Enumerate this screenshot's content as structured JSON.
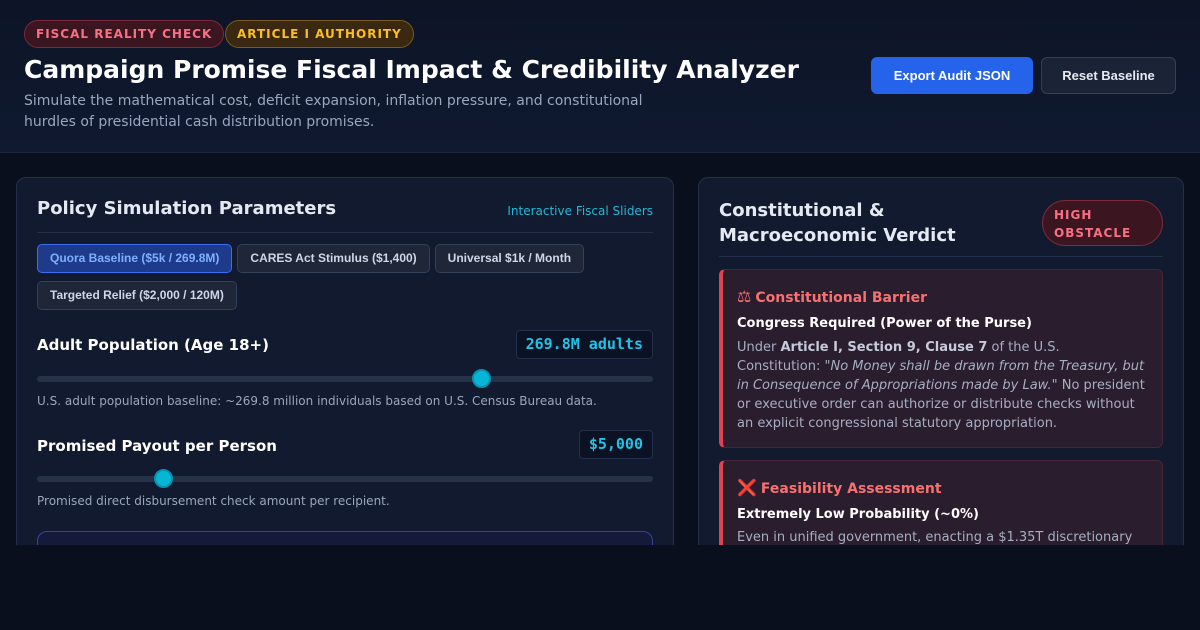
{
  "header": {
    "badges": [
      "FISCAL REALITY CHECK",
      "ARTICLE I AUTHORITY"
    ],
    "title": "Campaign Promise Fiscal Impact & Credibility Analyzer",
    "subtitle": "Simulate the mathematical cost, deficit expansion, inflation pressure, and constitutional hurdles of presidential cash distribution promises.",
    "export_label": "Export Audit JSON",
    "reset_label": "Reset Baseline"
  },
  "parameters": {
    "title": "Policy Simulation Parameters",
    "link": "Interactive Fiscal Sliders",
    "presets": [
      {
        "label": "Quora Baseline ($5k / 269.8M)",
        "active": true
      },
      {
        "label": "CARES Act Stimulus ($1,400)",
        "active": false
      },
      {
        "label": "Universal $1k / Month",
        "active": false
      },
      {
        "label": "Targeted Relief ($2,000 / 120M)",
        "active": false
      }
    ],
    "population": {
      "label": "Adult Population (Age 18+)",
      "value": "269.8M adults",
      "slider_fraction": 0.72,
      "help": "U.S. adult population baseline: ~269.8 million individuals based on U.S. Census Bureau data."
    },
    "payout": {
      "label": "Promised Payout per Person",
      "value": "$5,000",
      "slider_fraction": 0.205,
      "help": "Promised direct disbursement check amount per recipient."
    }
  },
  "verdict": {
    "title": "Constitutional & Macroeconomic Verdict",
    "risk_level": "HIGH OBSTACLE",
    "cards": [
      {
        "icon": "⚖",
        "heading": "Constitutional Barrier",
        "subheading": "Congress Required (Power of the Purse)",
        "body_prefix": "Under ",
        "body_bold": "Article I, Section 9, Clause 7",
        "body_mid": " of the U.S. Constitution: \"",
        "body_italic": "No Money shall be drawn from the Treasury, but in Consequence of Appropriations made by Law.",
        "body_suffix": "\" No president or executive order can authorize or distribute checks without an explicit congressional statutory appropriation."
      },
      {
        "icon": "❌",
        "heading": "Feasibility Assessment",
        "subheading": "Extremely Low Probability (~0%)",
        "body": "Even in unified government, enacting a $1.35T discretionary"
      }
    ]
  },
  "colors": {
    "accent": "#2563eb",
    "slider": "#06b6d4",
    "danger": "#f87171",
    "warning": "#fbbf24"
  }
}
